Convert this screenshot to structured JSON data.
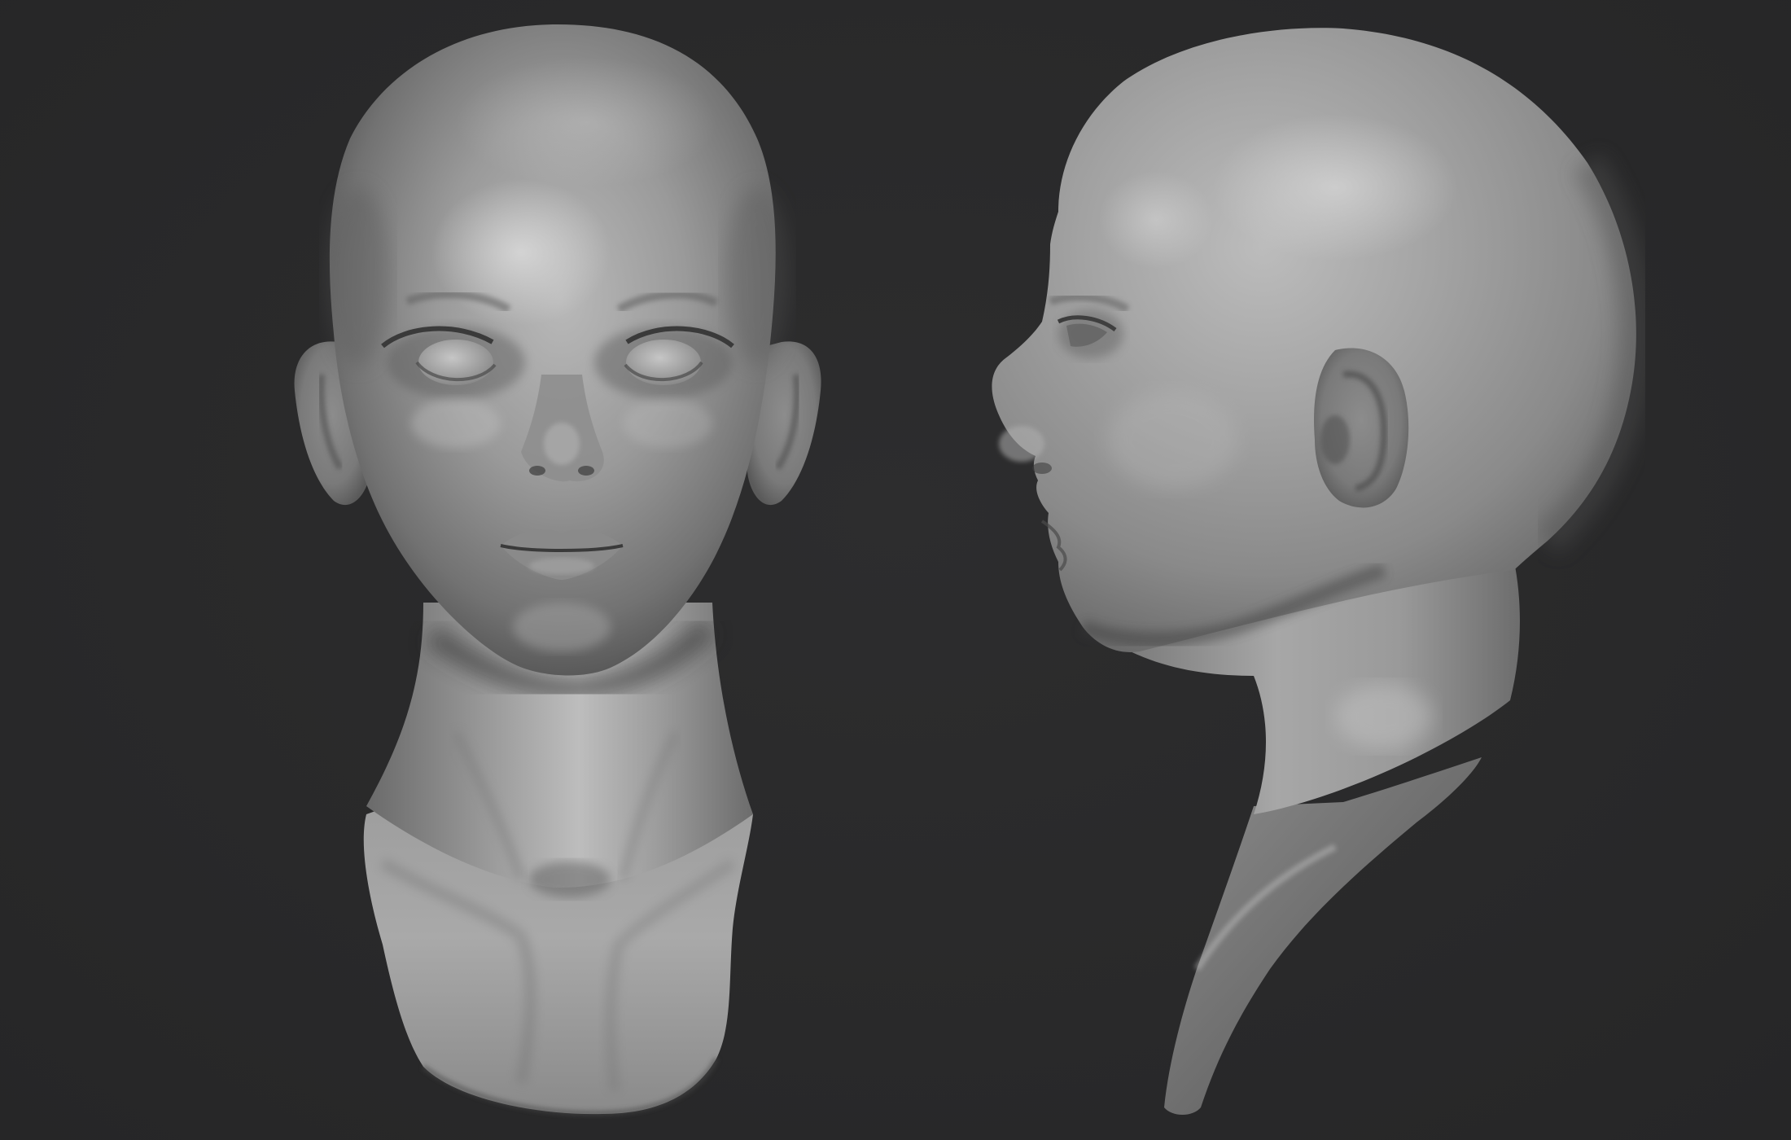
{
  "scene": {
    "background_color": "#2a2a2b",
    "material_base_color": "#8f8f8f",
    "material_highlight_color": "#c9c9c9",
    "material_shadow_color": "#3a3a3a",
    "views": [
      {
        "view": "front",
        "icon": "front-head-sculpt"
      },
      {
        "view": "profile-left",
        "icon": "profile-head-sculpt"
      }
    ]
  }
}
